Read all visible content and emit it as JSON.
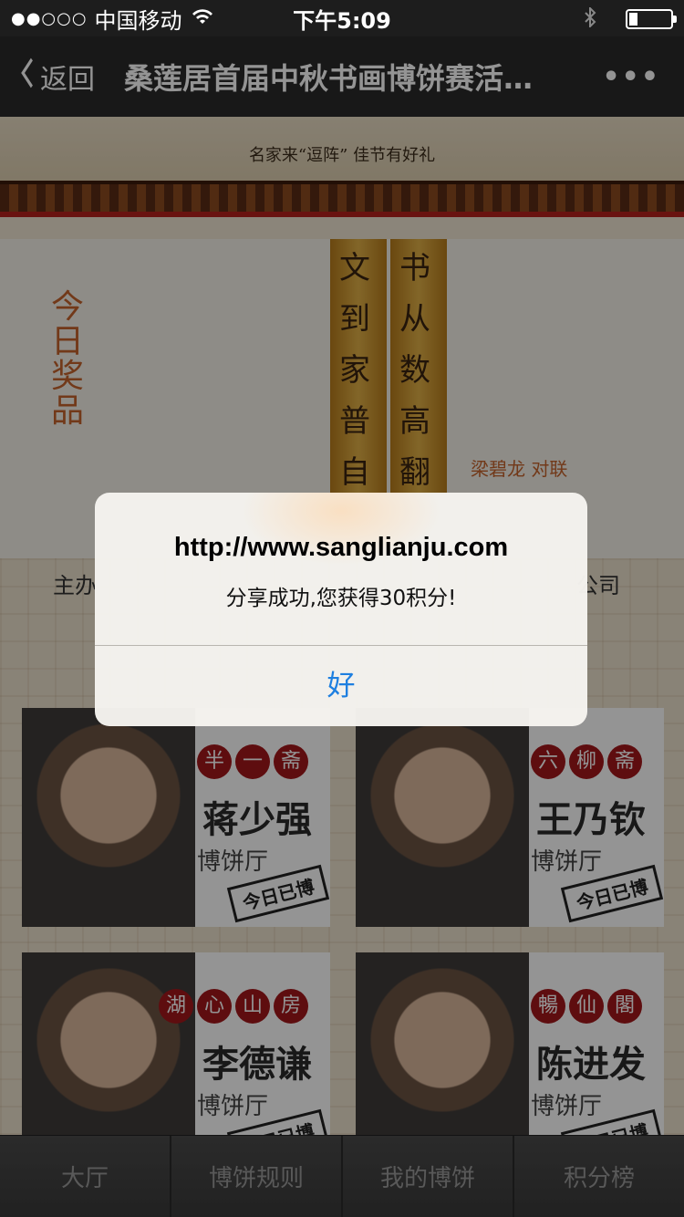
{
  "status_bar": {
    "signal": "●●○○○",
    "carrier": "中国移动",
    "time": "下午5:09",
    "battery_level": 0.2
  },
  "nav": {
    "back_label": "返回",
    "title": "桑莲居首届中秋书画博饼赛活…",
    "more_label": "•••"
  },
  "banner": {
    "slogan": "名家来“逗阵” 佳节有好礼"
  },
  "prize": {
    "label": "今日奖品",
    "calligraphy_left": "文到家普自",
    "calligraphy_right": "书从数高翻",
    "caption": "梁碧龙 对联"
  },
  "sponsor": {
    "left": "主办",
    "right": "公司"
  },
  "cards": [
    {
      "studio": [
        "半",
        "一",
        "斋"
      ],
      "name": "蒋少强",
      "hall": "博饼厅",
      "stamp": "今日已博"
    },
    {
      "studio": [
        "六",
        "柳",
        "斋"
      ],
      "name": "王乃钦",
      "hall": "博饼厅",
      "stamp": "今日已博"
    },
    {
      "studio": [
        "湖",
        "心",
        "山",
        "房"
      ],
      "name": "李德谦",
      "hall": "博饼厅",
      "stamp": "今日已博"
    },
    {
      "studio": [
        "暢",
        "仙",
        "閣"
      ],
      "name": "陈进发",
      "hall": "博饼厅",
      "stamp": "今日已博"
    }
  ],
  "alert": {
    "title": "http://www.sanglianju.com",
    "message": "分享成功,您获得30积分!",
    "ok_label": "好"
  },
  "tabs": [
    {
      "label": "大厅"
    },
    {
      "label": "博饼规则"
    },
    {
      "label": "我的博饼"
    },
    {
      "label": "积分榜"
    }
  ]
}
